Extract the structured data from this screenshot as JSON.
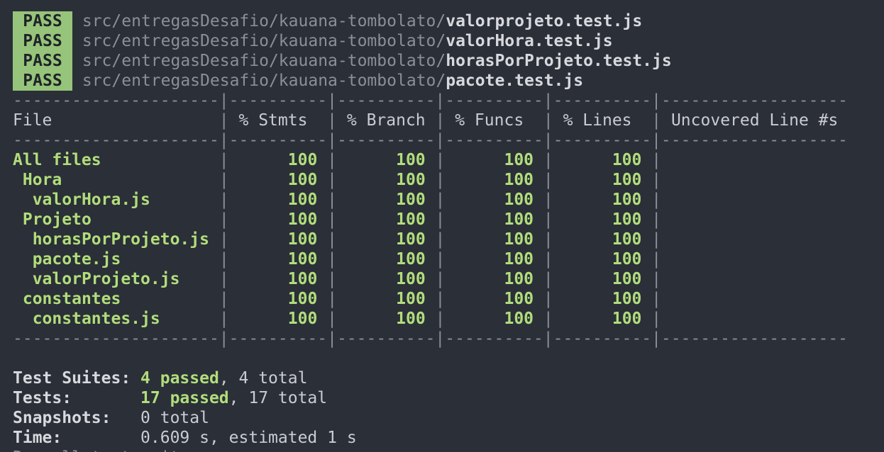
{
  "pass_lines": [
    {
      "badge": "PASS",
      "dir": "src/entregasDesafio/kauana-tombolato/",
      "file": "valorprojeto.test.js"
    },
    {
      "badge": "PASS",
      "dir": "src/entregasDesafio/kauana-tombolato/",
      "file": "valorHora.test.js"
    },
    {
      "badge": "PASS",
      "dir": "src/entregasDesafio/kauana-tombolato/",
      "file": "horasPorProjeto.test.js"
    },
    {
      "badge": "PASS",
      "dir": "src/entregasDesafio/kauana-tombolato/",
      "file": "pacote.test.js"
    }
  ],
  "coverage": {
    "separator": "---------------------|----------|----------|----------|----------|-------------------",
    "headers": [
      "File",
      "% Stmts",
      "% Branch",
      "% Funcs",
      "% Lines",
      "Uncovered Line #s"
    ],
    "rows": [
      {
        "name": "All files",
        "indent": 0,
        "stmts": "100",
        "branch": "100",
        "funcs": "100",
        "lines": "100",
        "uncovered": ""
      },
      {
        "name": "Hora",
        "indent": 1,
        "stmts": "100",
        "branch": "100",
        "funcs": "100",
        "lines": "100",
        "uncovered": ""
      },
      {
        "name": "valorHora.js",
        "indent": 2,
        "stmts": "100",
        "branch": "100",
        "funcs": "100",
        "lines": "100",
        "uncovered": ""
      },
      {
        "name": "Projeto",
        "indent": 1,
        "stmts": "100",
        "branch": "100",
        "funcs": "100",
        "lines": "100",
        "uncovered": ""
      },
      {
        "name": "horasPorProjeto.js",
        "indent": 2,
        "stmts": "100",
        "branch": "100",
        "funcs": "100",
        "lines": "100",
        "uncovered": ""
      },
      {
        "name": "pacote.js",
        "indent": 2,
        "stmts": "100",
        "branch": "100",
        "funcs": "100",
        "lines": "100",
        "uncovered": ""
      },
      {
        "name": "valorProjeto.js",
        "indent": 2,
        "stmts": "100",
        "branch": "100",
        "funcs": "100",
        "lines": "100",
        "uncovered": ""
      },
      {
        "name": "constantes",
        "indent": 1,
        "stmts": "100",
        "branch": "100",
        "funcs": "100",
        "lines": "100",
        "uncovered": ""
      },
      {
        "name": "constantes.js",
        "indent": 2,
        "stmts": "100",
        "branch": "100",
        "funcs": "100",
        "lines": "100",
        "uncovered": ""
      }
    ]
  },
  "summary": [
    {
      "label": "Test Suites:",
      "highlight": "4 passed",
      "rest": ", 4 total"
    },
    {
      "label": "Tests:",
      "highlight": "17 passed",
      "rest": ", 17 total"
    },
    {
      "label": "Snapshots:",
      "highlight": "",
      "rest": "0 total"
    },
    {
      "label": "Time:",
      "highlight": "",
      "rest": "0.609 s, estimated 1 s"
    }
  ],
  "footer_partial": "Ran all test suites."
}
